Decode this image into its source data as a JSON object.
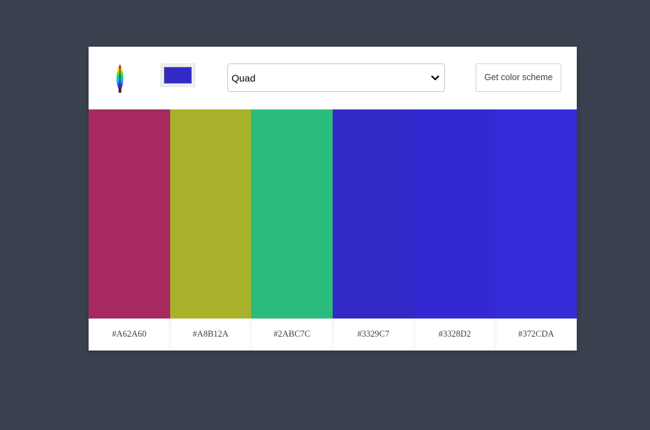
{
  "header": {
    "logo_icon": "color-wheel-icon",
    "seed_color": "#3329C7",
    "mode": {
      "selected": "Quad",
      "icon": "chevron-down-icon"
    },
    "button_label": "Get color scheme"
  },
  "palette": {
    "colors": [
      {
        "hex": "#A62A60",
        "label": "#A62A60"
      },
      {
        "hex": "#A8B12A",
        "label": "#A8B12A"
      },
      {
        "hex": "#2ABC7C",
        "label": "#2ABC7C"
      },
      {
        "hex": "#3329C7",
        "label": "#3329C7"
      },
      {
        "hex": "#3328D2",
        "label": "#3328D2"
      },
      {
        "hex": "#372CDA",
        "label": "#372CDA"
      }
    ]
  },
  "theme": {
    "page_background": "#3a4250",
    "card_background": "#ffffff"
  }
}
